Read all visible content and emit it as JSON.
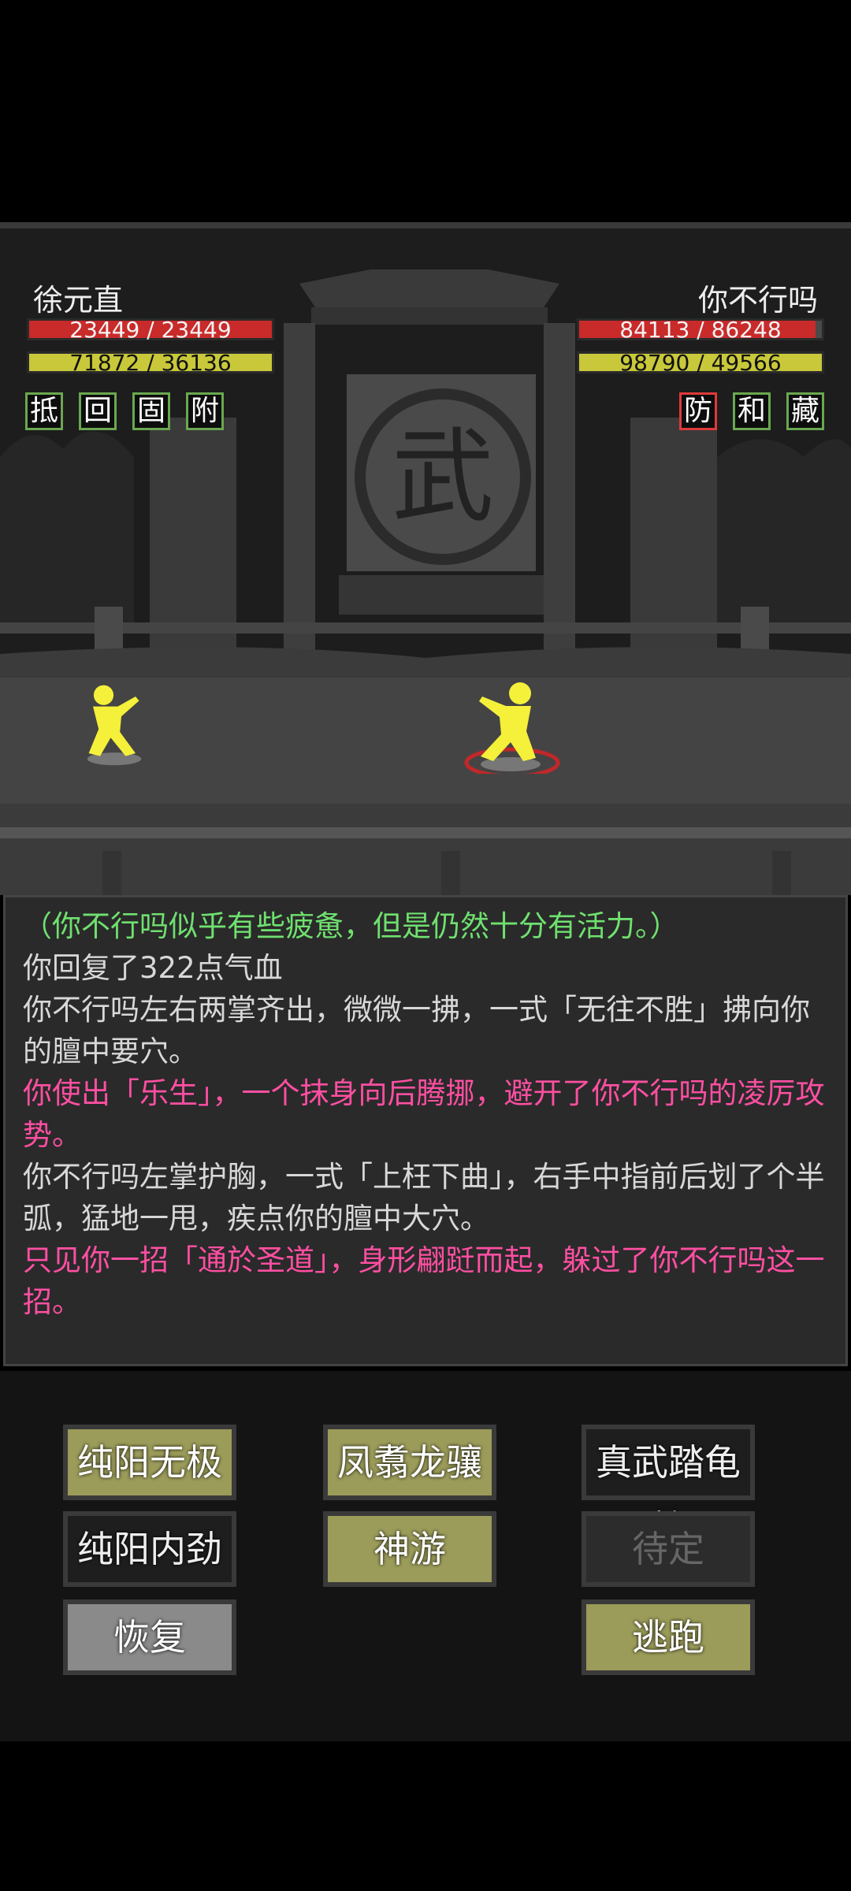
{
  "player": {
    "name": "徐元直",
    "hp_text": "23449 / 23449",
    "hp_fraction": 1.0,
    "mp_text": "71872 / 36136",
    "mp_fraction": 1.0,
    "buffs": [
      "抵",
      "回",
      "固",
      "附"
    ]
  },
  "enemy": {
    "name": "你不行吗",
    "hp_text": "84113 / 86248",
    "hp_fraction": 0.975,
    "mp_text": "98790 / 49566",
    "mp_fraction": 1.0,
    "buffs": [
      "防",
      "和",
      "藏"
    ]
  },
  "scene": {
    "gate_symbol": "武"
  },
  "log": [
    {
      "text": "（你不行吗似乎有些疲惫，但是仍然十分有活力。）",
      "color": "green"
    },
    {
      "text": "你回复了322点气血",
      "color": "grey"
    },
    {
      "text": "你不行吗左右两掌齐出，微微一拂，一式「无往不胜」拂向你的膻中要穴。",
      "color": "grey"
    },
    {
      "text": "你使出「乐生」，一个抹身向后腾挪，避开了你不行吗的凌厉攻势。",
      "color": "pink"
    },
    {
      "text": "你不行吗左掌护胸，一式「上枉下曲」，右手中指前后划了个半弧，猛地一甩，疾点你的膻中大穴。",
      "color": "grey"
    },
    {
      "text": "只见你一招「通於圣道」，身形翩跹而起，躲过了你不行吗这一招。",
      "color": "pink"
    }
  ],
  "skills": {
    "skill1": "纯阳无极",
    "skill2": "凤翥龙骧",
    "skill3": "真武踏龟蛇",
    "skill4": "纯阳内劲",
    "skill5": "神游",
    "skill6": "待定",
    "recover": "恢复",
    "flee": "逃跑"
  },
  "colors": {
    "hp": "#c92a2a",
    "mp": "#c8c83a",
    "buff_green": "#6aa84f",
    "buff_red": "#e03a3a",
    "log_green": "#6fe06f",
    "log_pink": "#ff4fa2",
    "button_olive": "#9b9b5a"
  }
}
